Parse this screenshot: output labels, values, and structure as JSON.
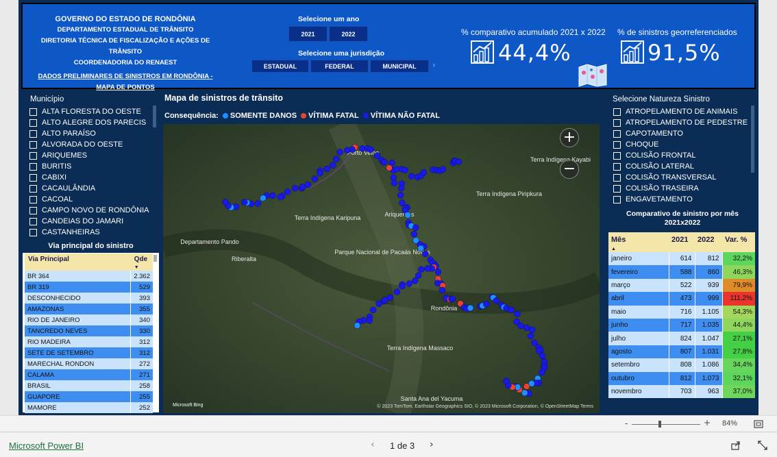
{
  "header": {
    "gov_lines": [
      "GOVERNO  DO ESTADO DE RONDÔNIA",
      "DEPARTAMENTO ESTADUAL DE TRÂNSITO",
      "DIRETORIA TÉCNICA DE FISCALIZAÇÃO E AÇÕES DE TRÂNSITO",
      "COORDENADORIA DO RENAEST"
    ],
    "link_line1": "DADOS PRELIMINARES DE SINISTROS EM RONDÔNIA -",
    "link_line2": "MAPA DE PONTOS",
    "year_label": "Selecione um ano",
    "years": [
      "2021",
      "2022"
    ],
    "jurisdiction_label": "Selecione uma jurisdição",
    "jurisdictions": [
      "ESTADUAL",
      "FEDERAL",
      "MUNICIPAL"
    ],
    "kpi1_label": "% comparativo acumulado 2021 x 2022",
    "kpi1_value": "44,4%",
    "kpi2_label": "% de sinistros georreferenciados",
    "kpi2_value": "91,5%",
    "kpi_icon": "chart-growth-icon",
    "map_icon": "folded-map-icon"
  },
  "municipio": {
    "title": "Município",
    "items": [
      "ALTA FLORESTA DO OESTE",
      "ALTO ALEGRE DOS PARECIS",
      "ALTO PARAÍSO",
      "ALVORADA DO OESTE",
      "ARIQUEMES",
      "BURITIS",
      "CABIXI",
      "CACAULÂNDIA",
      "CACOAL",
      "CAMPO NOVO DE RONDÔNIA",
      "CANDEIAS DO JAMARI",
      "CASTANHEIRAS"
    ]
  },
  "via": {
    "title": "Via principal do sinistro",
    "col1": "Via Principal",
    "col2": "Qde",
    "rows": [
      [
        "BR 364",
        "2.362"
      ],
      [
        "BR 319",
        "529"
      ],
      [
        "DESCONHECIDO",
        "393"
      ],
      [
        "AMAZONAS",
        "355"
      ],
      [
        "RIO DE JANEIRO",
        "340"
      ],
      [
        "TANCREDO NEVES",
        "330"
      ],
      [
        "RIO MADEIRA",
        "312"
      ],
      [
        "SETE DE SETEMBRO",
        "312"
      ],
      [
        "MARECHAL RONDON",
        "272"
      ],
      [
        "CALAMA",
        "271"
      ],
      [
        "BRASIL",
        "258"
      ],
      [
        "GUAPORE",
        "255"
      ],
      [
        "MAMORE",
        "252"
      ]
    ]
  },
  "map": {
    "title": "Mapa de sinistros de trânsito",
    "legend_label": "Consequência:",
    "legend": [
      {
        "label": "SOMENTE DANOS",
        "color": "#1e90ff"
      },
      {
        "label": "VÍTIMA FATAL",
        "color": "#e8452c"
      },
      {
        "label": "VÍTIMA NÃO FATAL",
        "color": "#1a1ae6"
      }
    ],
    "zoom_in": "+",
    "zoom_out": "−",
    "places": [
      "Porto Velho",
      "Ariquemes",
      "Riberalta",
      "Rondônia",
      "Santa Ana del Yacuma",
      "Terra Indígena Karipuna",
      "Parque Nacional de Pacaás Novos",
      "Terra Indígena Piripkura",
      "Terra Indígena Kayabi",
      "Departamento Pando",
      "Terra Indígena Massaco"
    ],
    "attribution": "© 2023 TomTom, Earthstar Geographics SIO, © 2023 Microsoft Corporation, © OpenStreetMap  Terms",
    "bing": "Microsoft Bing"
  },
  "natureza": {
    "title": "Selecione Natureza Sinistro",
    "items": [
      "ATROPELAMENTO DE ANIMAIS",
      "ATROPELAMENTO DE PEDESTRE",
      "CAPOTAMENTO",
      "CHOQUE",
      "COLISÃO FRONTAL",
      "COLISÃO LATERAL",
      "COLISÃO TRANSVERSAL",
      "COLISÃO TRASEIRA",
      "ENGAVETAMENTO"
    ]
  },
  "monthly": {
    "title": "Comparativo de sinistro por mês 2021x2022",
    "cols": [
      "Mês",
      "2021",
      "2022",
      "Var. %"
    ],
    "rows": [
      [
        "janeiro",
        "614",
        "812",
        "32,2%",
        "#5cd65c"
      ],
      [
        "fevereiro",
        "588",
        "860",
        "46,3%",
        "#8fd65c"
      ],
      [
        "março",
        "522",
        "939",
        "79,9%",
        "#e08a2a"
      ],
      [
        "abril",
        "473",
        "999",
        "111,2%",
        "#e8342a"
      ],
      [
        "maio",
        "716",
        "1.105",
        "54,3%",
        "#a3d65c"
      ],
      [
        "junho",
        "717",
        "1.035",
        "44,4%",
        "#8fd65c"
      ],
      [
        "julho",
        "824",
        "1.047",
        "27,1%",
        "#44d044"
      ],
      [
        "agosto",
        "807",
        "1.031",
        "27,8%",
        "#44d044"
      ],
      [
        "setembro",
        "808",
        "1.086",
        "34,4%",
        "#66d65c"
      ],
      [
        "outubro",
        "812",
        "1.073",
        "32,1%",
        "#5cd65c"
      ],
      [
        "novembro",
        "703",
        "963",
        "37,0%",
        "#6fd65c"
      ]
    ]
  },
  "status": {
    "zoom_minus": "-",
    "zoom_plus": "+",
    "zoom": "84%",
    "fit_icon": "fit-page-icon"
  },
  "footer": {
    "app": "Microsoft Power BI",
    "page": "1 de 3",
    "share_icon": "share-icon",
    "expand_icon": "fullscreen-icon"
  }
}
